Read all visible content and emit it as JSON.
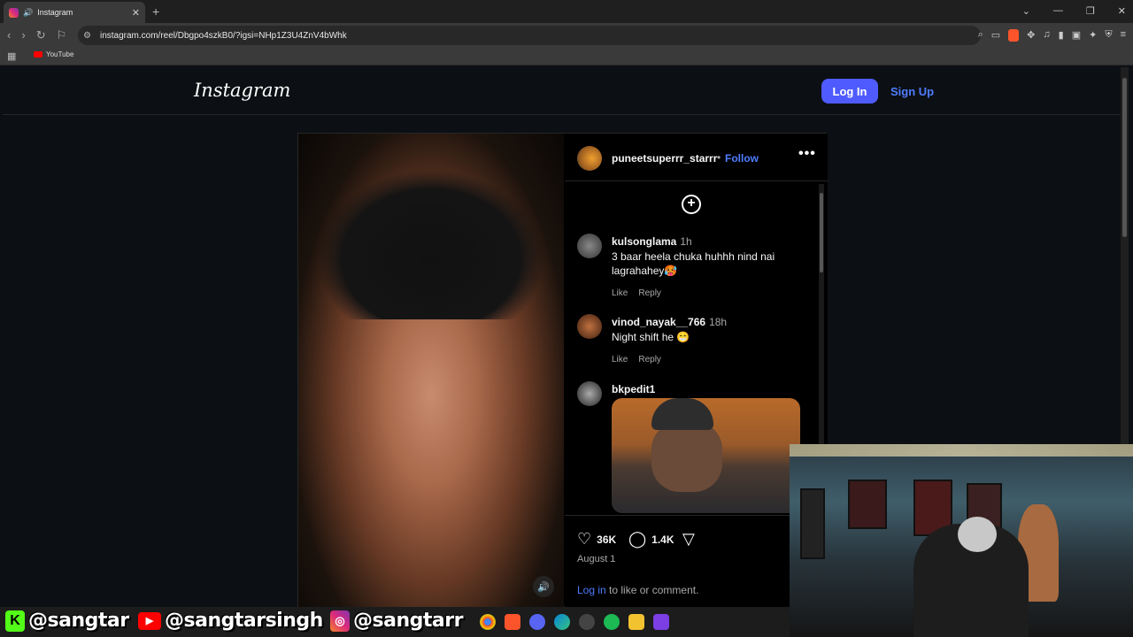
{
  "browser": {
    "tab_title": "Instagram",
    "url": "instagram.com/reel/Dbgpo4szkB0/?igsi=NHp1Z3U4ZnV4bWhk",
    "bookmark_youtube": "YouTube"
  },
  "instagram": {
    "logo": "Instagram",
    "login_label": "Log In",
    "signup_label": "Sign Up",
    "post": {
      "username": "puneetsuperrr_starrr",
      "dot": "•",
      "follow_label": "Follow",
      "likes": "36K",
      "comments": "1.4K",
      "date": "August 1",
      "login_link": "Log in",
      "login_suffix": " to like or comment."
    },
    "comments": [
      {
        "user": "kulsonglama",
        "time": "1h",
        "text": "3 baar heela chuka huhhh nind nai lagrahahey🥵",
        "like": "Like",
        "reply": "Reply"
      },
      {
        "user": "vinod_nayak__766",
        "time": "18h",
        "text": "Night shift he 😁",
        "like": "Like",
        "reply": "Reply"
      },
      {
        "user": "bkpedit1",
        "time": "",
        "text": ""
      }
    ]
  },
  "overlay": {
    "kick_handle": "@sangtar",
    "youtube_handle": "@sangtarsingh",
    "instagram_handle": "@sangtarr"
  },
  "colors": {
    "accent": "#4f5bff",
    "link": "#4f7cff",
    "background": "#0c1014"
  }
}
